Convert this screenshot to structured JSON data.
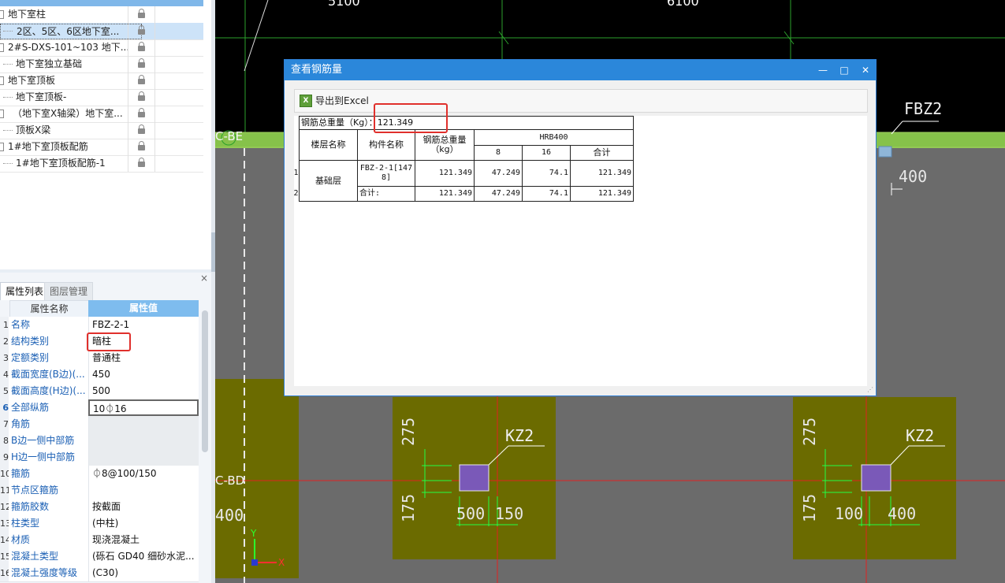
{
  "layer_tree": {
    "items": [
      {
        "label": "地下室柱",
        "locked": true
      },
      {
        "label": "2区、5区、6区地下室...",
        "locked": true,
        "selected": true
      },
      {
        "label": "2#S-DXS-101~103 地下...",
        "locked": true
      },
      {
        "label": "地下室独立基础",
        "locked": true
      },
      {
        "label": "地下室顶板",
        "locked": true
      },
      {
        "label": "地下室顶板-",
        "locked": true
      },
      {
        "label": "（地下室X轴梁）地下室...",
        "locked": true
      },
      {
        "label": "顶板X梁",
        "locked": true
      },
      {
        "label": "1#地下室顶板配筋",
        "locked": true
      },
      {
        "label": "1#地下室顶板配筋-1",
        "locked": true
      }
    ]
  },
  "properties_panel": {
    "close_icon": "×",
    "tabs": {
      "active": "属性列表",
      "inactive": "图层管理"
    },
    "header": {
      "name": "属性名称",
      "value": "属性值"
    },
    "rows": [
      {
        "num": "1",
        "name": "名称",
        "value": "FBZ-2-1"
      },
      {
        "num": "2",
        "name": "结构类别",
        "value": "暗柱"
      },
      {
        "num": "3",
        "name": "定额类别",
        "value": "普通柱"
      },
      {
        "num": "4",
        "name": "截面宽度(B边)(...",
        "value": "450"
      },
      {
        "num": "5",
        "name": "截面高度(H边)(...",
        "value": "500"
      },
      {
        "num": "6",
        "name": "全部纵筋",
        "value": "10⏀16"
      },
      {
        "num": "7",
        "name": "角筋",
        "value": ""
      },
      {
        "num": "8",
        "name": "B边一侧中部筋",
        "value": ""
      },
      {
        "num": "9",
        "name": "H边一侧中部筋",
        "value": ""
      },
      {
        "num": "10",
        "name": "箍筋",
        "value": "⏀8@100/150"
      },
      {
        "num": "11",
        "name": "节点区箍筋",
        "value": ""
      },
      {
        "num": "12",
        "name": "箍筋胶数",
        "value": "按截面"
      },
      {
        "num": "13",
        "name": "柱类型",
        "value": "(中柱)"
      },
      {
        "num": "14",
        "name": "材质",
        "value": "现浇混凝土"
      },
      {
        "num": "15",
        "name": "混凝土类型",
        "value": "(砾石 GD40 细砂水泥..."
      },
      {
        "num": "16",
        "name": "混凝土强度等级",
        "value": "(C30)"
      }
    ]
  },
  "cad": {
    "labels": {
      "dim_top_left": "5100",
      "dim_top_right": "6100",
      "axis_be": "C-BE",
      "axis_bd": "C-BD",
      "fbz2": "FBZ2",
      "kz2_a": "KZ2",
      "kz2_b": "KZ2",
      "dim_400_top": "400",
      "dim_400_left": "400",
      "dim_275_a": "275",
      "dim_175_a": "175",
      "dim_500": "500",
      "dim_150": "150",
      "dim_275_b": "275",
      "dim_175_b": "175",
      "dim_100": "100",
      "dim_400_b": "400",
      "ucs_y": "Y",
      "ucs_x": "X"
    }
  },
  "dialog": {
    "title": "查看钢筋量",
    "minimize": "—",
    "maximize": "□",
    "close": "✕",
    "export_label": "导出到Excel",
    "export_icon": "excel-icon",
    "table": {
      "total_label": "钢筋总重量（Kg）：121.349",
      "headers": {
        "floor": "楼层名称",
        "component": "构件名称",
        "total_weight": "钢筋总重量（kg）",
        "grade": "HRB400",
        "d8": "8",
        "d16": "16",
        "subtotal": "合计"
      },
      "rows": [
        {
          "num": "1",
          "floor": "基础层",
          "component": "FBZ-2-1[1478]",
          "total": "121.349",
          "d8": "47.249",
          "d16": "74.1",
          "sum": "121.349"
        },
        {
          "num": "2",
          "floor": "",
          "component": "合计:",
          "total": "121.349",
          "d8": "47.249",
          "d16": "74.1",
          "sum": "121.349"
        }
      ]
    }
  },
  "colors": {
    "dialog_titlebar": "#2b87da",
    "highlight": "#e0302c",
    "cad_background": "#6b6b6b",
    "cad_green_band": "#86c24a",
    "cad_olive": "#6b6b00"
  }
}
